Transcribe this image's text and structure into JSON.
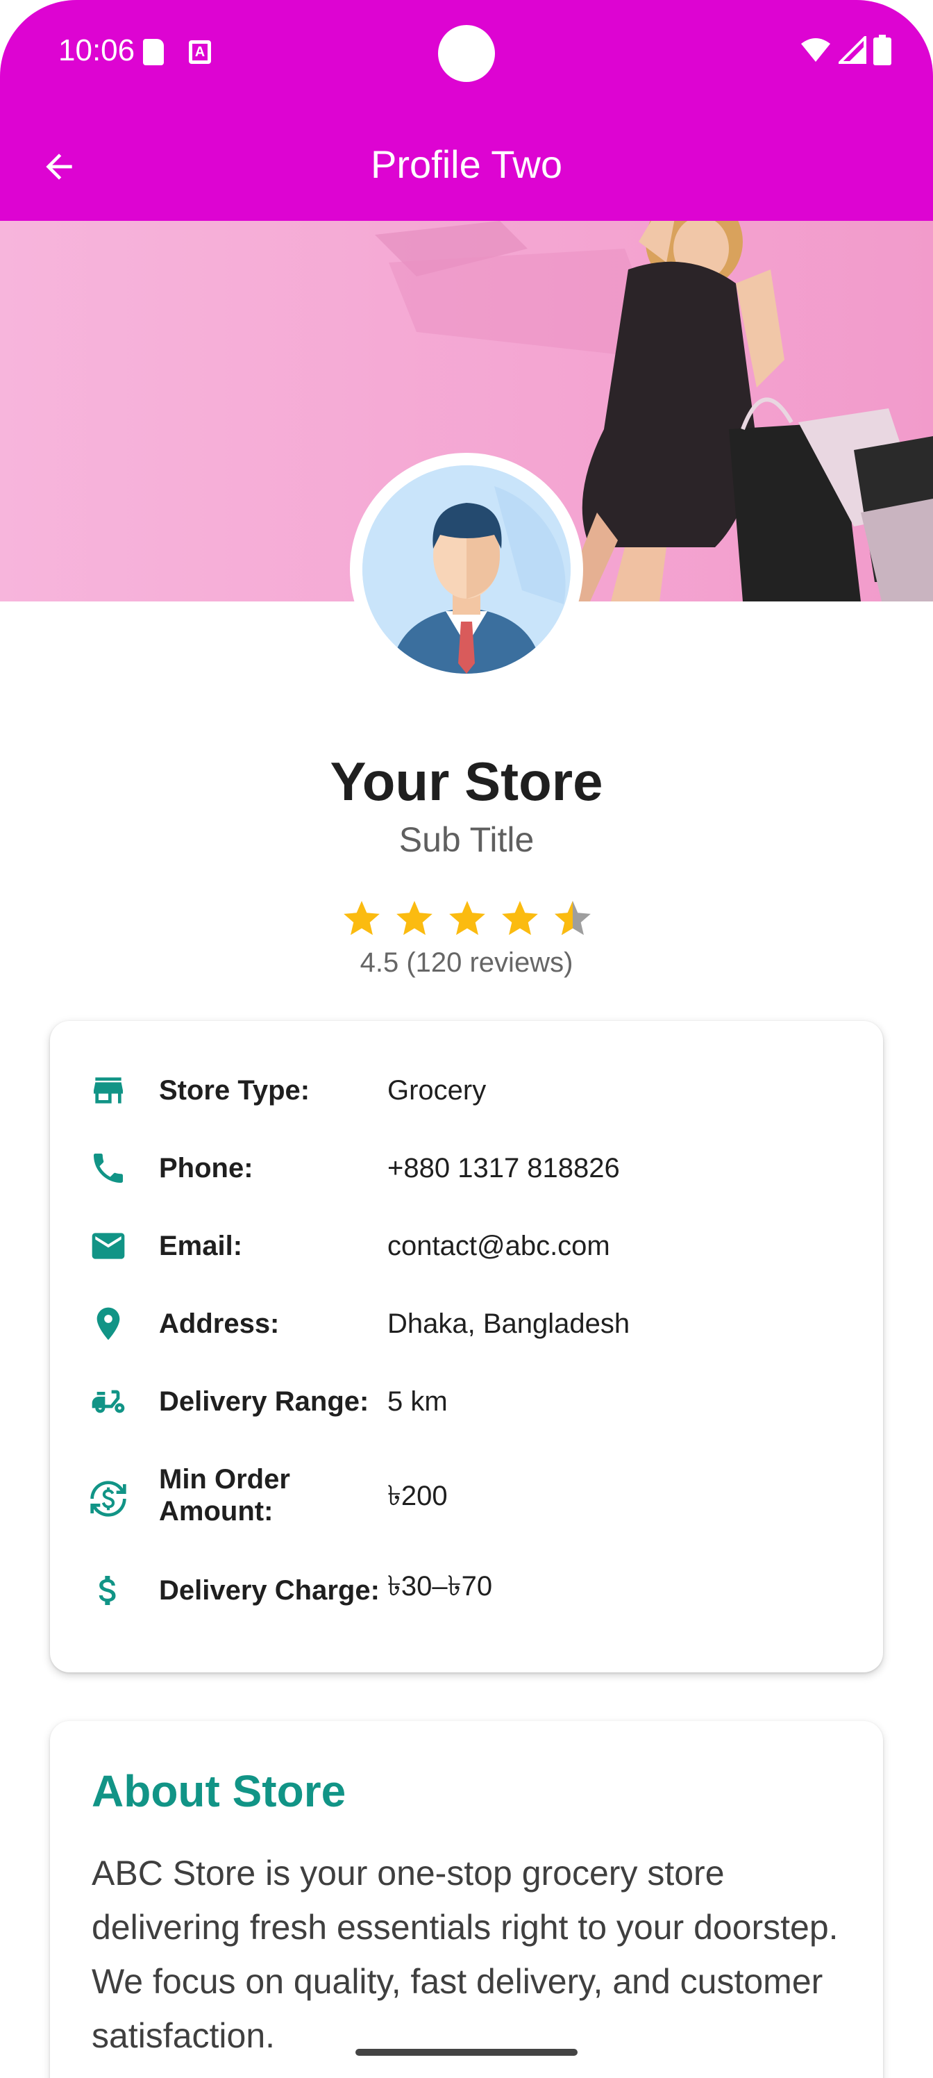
{
  "status_bar": {
    "time": "10:06",
    "a_icon_letter": "A",
    "icons": [
      "sd-card-icon",
      "a-box-icon",
      "wifi-icon",
      "signal-icon",
      "battery-icon"
    ]
  },
  "app_bar": {
    "title": "Profile Two",
    "back_icon": "arrow-left-icon",
    "color": "#dd04d2"
  },
  "profile": {
    "name": "Your Store",
    "subtitle": "Sub Title",
    "rating_value": 4.5,
    "rating_max": 5,
    "rating_text": "4.5 (120 reviews)"
  },
  "info": {
    "accent_color": "#119486",
    "rows": [
      {
        "icon": "store-icon",
        "label": "Store Type:",
        "value": "Grocery"
      },
      {
        "icon": "phone-icon",
        "label": "Phone:",
        "value": "+880 1317 818826"
      },
      {
        "icon": "email-icon",
        "label": "Email:",
        "value": "contact@abc.com"
      },
      {
        "icon": "location-pin-icon",
        "label": "Address:",
        "value": "Dhaka, Bangladesh"
      },
      {
        "icon": "delivery-scooter-icon",
        "label": "Delivery Range:",
        "value": "5 km"
      },
      {
        "icon": "currency-exchange-icon",
        "label_line1": "Min Order",
        "label_line2": "Amount:",
        "value": "৳200"
      },
      {
        "icon": "dollar-icon",
        "label": "Delivery Charge:",
        "value": "৳30–৳70"
      }
    ]
  },
  "about": {
    "title": "About Store",
    "text": "ABC Store is your one-stop grocery store delivering fresh essentials right to your doorstep. We focus on quality, fast delivery, and customer satisfaction."
  }
}
